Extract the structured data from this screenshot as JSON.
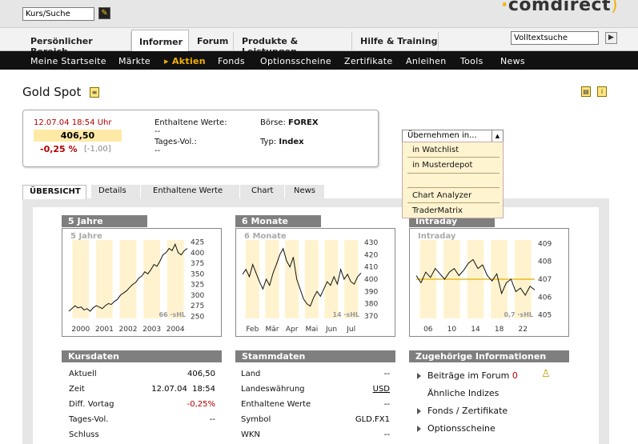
{
  "header": {
    "search_placeholder": "Kurs/Suche",
    "go_icon": "pencil-icon",
    "logo": "comdirect",
    "fulltext_placeholder": "Volltextsuche",
    "fulltext_go": "▶"
  },
  "nav1": {
    "tabs": [
      "Persönlicher Bereich",
      "Informer",
      "Forum",
      "Produkte & Leistungen",
      "Hilfe & Training"
    ],
    "active": "Informer"
  },
  "nav2": {
    "items": [
      "Meine Startseite",
      "Märkte",
      "Aktien",
      "Fonds",
      "Optionsscheine",
      "Zertifikate",
      "Anleihen",
      "Tools",
      "News"
    ],
    "active": "Aktien"
  },
  "page": {
    "title": "Gold Spot"
  },
  "quote": {
    "time": "12.07.04 18:54 Uhr",
    "price": "406,50",
    "change_pct": "-0,25 %",
    "change_abs": "[-1,00]",
    "enthaltene_label": "Enthaltene Werte:",
    "enthaltene_value": "--",
    "tagesvol_label": "Tages-Vol.:",
    "tagesvol_value": "--",
    "boerse_label": "Börse:",
    "boerse_value": "FOREX",
    "typ_label": "Typ:",
    "typ_value": "Index"
  },
  "dropdown": {
    "selected": "Übernehmen in...",
    "options": [
      "in Watchlist",
      "in Musterdepot",
      "",
      "Chart Analyzer",
      "TraderMatrix"
    ]
  },
  "tabs": [
    "ÜBERSICHT",
    "Details",
    "Enthaltene Werte",
    "Chart",
    "News"
  ],
  "chart_data": [
    {
      "type": "line",
      "title": "5 Jahre",
      "subtitle": "5 Jahre",
      "x": [
        "2000",
        "2001",
        "2002",
        "2003",
        "2004"
      ],
      "yticks": [
        250,
        275,
        300,
        325,
        350,
        375,
        400,
        425
      ],
      "ylim": [
        245,
        430
      ],
      "values": [
        262,
        268,
        275,
        270,
        272,
        265,
        268,
        262,
        270,
        275,
        272,
        268,
        275,
        280,
        278,
        285,
        290,
        300,
        305,
        310,
        318,
        325,
        330,
        340,
        345,
        355,
        350,
        360,
        372,
        368,
        380,
        395,
        400,
        410,
        405,
        420,
        400,
        395,
        405,
        410
      ],
      "watermark": "66 ·sHL"
    },
    {
      "type": "line",
      "title": "6 Monate",
      "subtitle": "6 Monate",
      "x": [
        "Feb",
        "Mär",
        "Apr",
        "Mai",
        "Jun",
        "Jul"
      ],
      "yticks": [
        370,
        380,
        390,
        400,
        410,
        420,
        430
      ],
      "ylim": [
        368,
        432
      ],
      "values": [
        404,
        408,
        402,
        412,
        405,
        398,
        392,
        400,
        395,
        405,
        412,
        420,
        425,
        415,
        410,
        418,
        400,
        392,
        384,
        380,
        378,
        385,
        390,
        386,
        392,
        398,
        395,
        402,
        396,
        408,
        400,
        404,
        398,
        396,
        402,
        405
      ],
      "watermark": "14 ·sHL"
    },
    {
      "type": "line",
      "title": "Intraday",
      "subtitle": "Intraday",
      "x": [
        "06",
        "10",
        "14",
        "18",
        "22"
      ],
      "yticks": [
        405,
        406,
        407,
        408,
        409
      ],
      "ylim": [
        404.8,
        409.2
      ],
      "values": [
        407.2,
        406.8,
        407.4,
        407.1,
        407.6,
        407.3,
        407.0,
        407.4,
        407.6,
        407.2,
        407.5,
        407.9,
        408.1,
        407.6,
        407.8,
        407.2,
        406.9,
        407.3,
        406.2,
        406.8,
        407.0,
        406.3,
        406.5,
        406.1,
        406.6,
        406.4
      ],
      "reference": 407.0,
      "watermark": "0,7 ·sHL"
    }
  ],
  "kursdaten": {
    "title": "Kursdaten",
    "rows": [
      [
        "Aktuell",
        "406,50"
      ],
      [
        "Zeit",
        "12.07.04  18:54"
      ],
      [
        "Diff. Vortag",
        "-0,25%"
      ],
      [
        "Tages-Vol.",
        "--"
      ],
      [
        "Schluss",
        ""
      ]
    ]
  },
  "stammdaten": {
    "title": "Stammdaten",
    "rows": [
      [
        "Land",
        "--"
      ],
      [
        "Landeswährung",
        "USD"
      ],
      [
        "Enthaltene Werte",
        "--"
      ],
      [
        "Symbol",
        "GLD.FX1"
      ],
      [
        "WKN",
        "--"
      ]
    ]
  },
  "info": {
    "title": "Zugehörige Informationen",
    "forum": "Beiträge im Forum",
    "forum_count": "0",
    "aehnliche": "Ähnliche Indizes",
    "fonds": "Fonds / Zertifikate",
    "os": "Optionsscheine"
  },
  "colors": {
    "accent": "#f3b000",
    "negative": "#b00000",
    "caption": "#7f7f7f"
  }
}
